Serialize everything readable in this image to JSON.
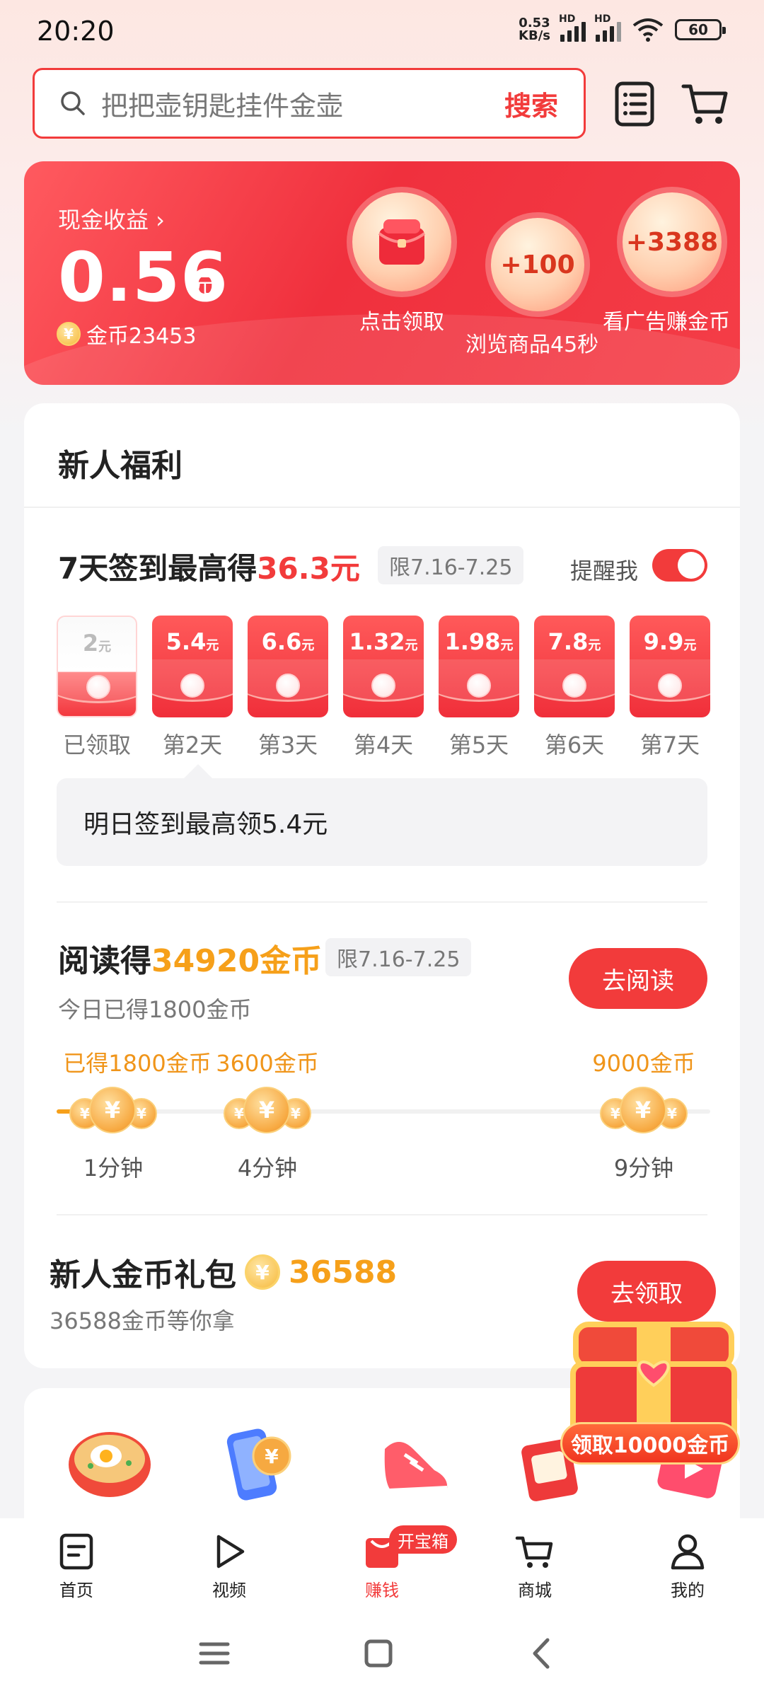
{
  "status_bar": {
    "time": "20:20",
    "net_speed_value": "0.53",
    "net_speed_unit": "KB/s",
    "hd1": "HD",
    "hd2": "HD",
    "battery": "60"
  },
  "search": {
    "placeholder": "把把壶钥匙挂件金壶",
    "button": "搜索"
  },
  "cash_card": {
    "label": "现金收益 ›",
    "amount": "0.56",
    "unit": "元",
    "coin_text": "金币23453",
    "bubbles": [
      {
        "caption": "点击领取"
      },
      {
        "value": "+100",
        "caption": "浏览商品45秒"
      },
      {
        "value": "+3388",
        "caption": "看广告赚金币"
      }
    ]
  },
  "newcomer": {
    "title": "新人福利",
    "signin": {
      "title_prefix": "7天签到最高得",
      "title_highlight": "36.3元",
      "date_tag": "限7.16-7.25",
      "remind_label": "提醒我",
      "remind_on": true,
      "days": [
        {
          "amount": "2",
          "label": "已领取",
          "claimed": true
        },
        {
          "amount": "5.4",
          "label": "第2天",
          "claimed": false
        },
        {
          "amount": "6.6",
          "label": "第3天",
          "claimed": false
        },
        {
          "amount": "1.32",
          "label": "第4天",
          "claimed": false
        },
        {
          "amount": "1.98",
          "label": "第5天",
          "claimed": false
        },
        {
          "amount": "7.8",
          "label": "第6天",
          "claimed": false
        },
        {
          "amount": "9.9",
          "label": "第7天",
          "claimed": false
        }
      ],
      "unit": "元",
      "tip": "明日签到最高领5.4元"
    },
    "reading": {
      "title_prefix": "阅读得",
      "title_highlight": "34920金币",
      "date_tag": "限7.16-7.25",
      "subtitle": "今日已得1800金币",
      "button": "去阅读",
      "progress": 0.13,
      "milestones": [
        {
          "reward": "已得1800金币",
          "time": "1分钟"
        },
        {
          "reward": "3600金币",
          "time": "4分钟"
        },
        {
          "reward": "9000金币",
          "time": "9分钟"
        }
      ]
    },
    "gift": {
      "title": "新人金币礼包",
      "amount": "36588",
      "subtitle": "36588金币等你拿",
      "button": "去领取"
    }
  },
  "floating_chest": {
    "label": "领取10000金币"
  },
  "categories": [
    {
      "icon": "noodle-bowl-icon"
    },
    {
      "icon": "phone-coin-icon"
    },
    {
      "icon": "sneaker-icon"
    },
    {
      "icon": "gift-box-icon"
    },
    {
      "icon": "phone-video-icon"
    }
  ],
  "tab_bar": [
    {
      "label": "首页",
      "icon": "home-icon"
    },
    {
      "label": "视频",
      "icon": "play-icon"
    },
    {
      "label": "赚钱",
      "icon": "earn-icon",
      "active": true,
      "badge": "开宝箱"
    },
    {
      "label": "商城",
      "icon": "cart-icon"
    },
    {
      "label": "我的",
      "icon": "profile-icon"
    }
  ],
  "colors": {
    "accent_red": "#f23b3b",
    "coin_orange": "#f6a01a"
  }
}
